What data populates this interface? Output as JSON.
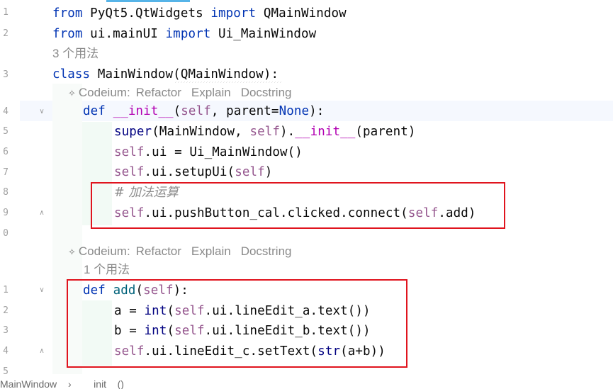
{
  "gutter": {
    "line_numbers": [
      "1",
      "2",
      "3",
      "4",
      "5",
      "6",
      "7",
      "8",
      "9",
      "0",
      "1",
      "2",
      "3",
      "4",
      "5"
    ]
  },
  "code": {
    "line1": {
      "kw1": "from",
      "mod": " PyQt5.QtWidgets ",
      "kw2": "import",
      "name": " QMainWindow"
    },
    "line2": {
      "kw1": "from",
      "mod": " ui.mainUI ",
      "kw2": "import",
      "name": " Ui_MainWindow"
    },
    "usage_hint_1": "3 个用法",
    "line3": {
      "kw": "class",
      "rest": " MainWindow(QMainWindow):"
    },
    "codeium_1": {
      "label": "Codeium:",
      "refactor": "Refactor",
      "explain": "Explain",
      "docstring": "Docstring"
    },
    "line4": {
      "kw": "def",
      "sp": " ",
      "fn": "__init__",
      "p1": "(",
      "self": "self",
      ", parent=": ", parent=",
      "none": "None",
      "end": "):"
    },
    "line5": {
      "bi": "super",
      "p1": "(MainWindow, ",
      "self": "self",
      "p2": ").",
      "magic": "__init__",
      "p3": "(parent)"
    },
    "line6": {
      "self": "self",
      "rest": ".ui = Ui_MainWindow()"
    },
    "line7": {
      "self": "self",
      "rest": ".ui.setupUi(",
      "self2": "self",
      "end": ")"
    },
    "line8": {
      "comment": "# 加法运算"
    },
    "line9": {
      "self": "self",
      "rest": ".ui.pushButton_cal.clicked.connect(",
      "self2": "self",
      "end": ".add)"
    },
    "codeium_2": {
      "label": "Codeium:",
      "refactor": "Refactor",
      "explain": "Explain",
      "docstring": "Docstring"
    },
    "usage_hint_2": "1 个用法",
    "line11": {
      "kw": "def",
      "sp": " ",
      "fn": "add",
      "p1": "(",
      "self": "self",
      "end": "):"
    },
    "line12": {
      "a": "a = ",
      "bi": "int",
      "p1": "(",
      "self": "self",
      "rest": ".ui.lineEdit_a.text())"
    },
    "line13": {
      "a": "b = ",
      "bi": "int",
      "p1": "(",
      "self": "self",
      "rest": ".ui.lineEdit_b.text())"
    },
    "line14": {
      "self": "self",
      "rest": ".ui.lineEdit_c.setText(",
      "bi": "str",
      "end": "(a+b))"
    }
  },
  "breadcrumb": {
    "left": "MainWindow",
    "sep": " › ",
    "right": "__init__()"
  },
  "colors": {
    "keyword": "#0033b3",
    "self": "#94558d",
    "magic": "#b200b2",
    "function": "#00627a",
    "builtin": "#000080",
    "comment": "#8c8c8c",
    "highlight": "#e0141e",
    "current_line": "#f5f8fe"
  }
}
